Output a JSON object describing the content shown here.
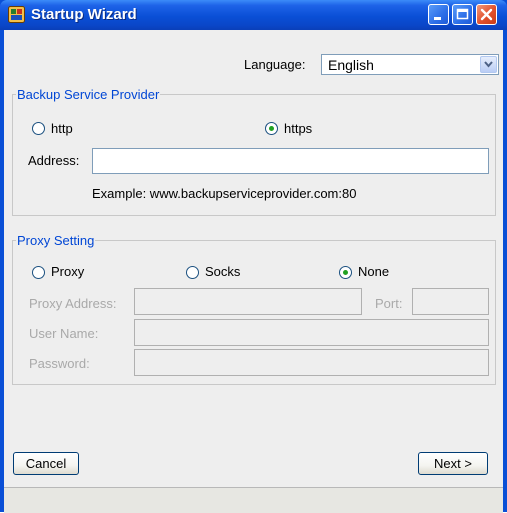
{
  "window": {
    "title": "Startup Wizard"
  },
  "language": {
    "label": "Language:",
    "value": "English"
  },
  "backup": {
    "legend": "Backup Service Provider",
    "options": [
      {
        "label": "http",
        "selected": false
      },
      {
        "label": "https",
        "selected": true
      }
    ],
    "address_label": "Address:",
    "address_value": "",
    "example": "Example: www.backupserviceprovider.com:80"
  },
  "proxy": {
    "legend": "Proxy Setting",
    "options": [
      {
        "label": "Proxy",
        "selected": false
      },
      {
        "label": "Socks",
        "selected": false
      },
      {
        "label": "None",
        "selected": true
      }
    ],
    "address_label": "Proxy Address:",
    "port_label": "Port:",
    "user_label": "User Name:",
    "password_label": "Password:"
  },
  "buttons": {
    "cancel": "Cancel",
    "next": "Next >"
  },
  "colors": {
    "title_bar": "#0a4fd6",
    "legend": "#0046d5",
    "radio_dot": "#21a121"
  }
}
